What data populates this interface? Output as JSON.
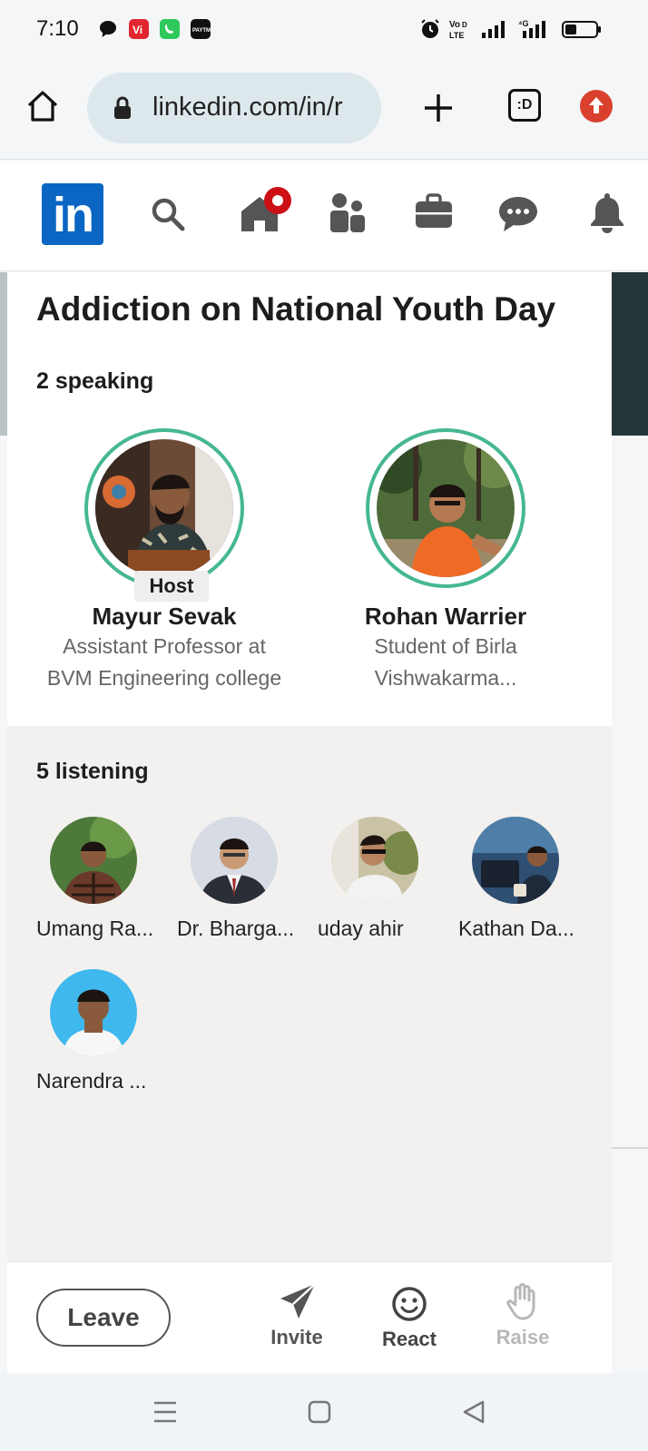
{
  "status_bar": {
    "time": "7:10"
  },
  "browser": {
    "url": "linkedin.com/in/r",
    "tab_switcher_label": ":D"
  },
  "linkedin_nav": {
    "logo": "in"
  },
  "room": {
    "title": "Addiction on National Youth Day",
    "speaking_count": "2 speaking",
    "speakers": [
      {
        "name": "Mayur Sevak",
        "badge": "Host",
        "subtitle_line1": "Assistant Professor at",
        "subtitle_line2": "BVM Engineering college"
      },
      {
        "name": "Rohan Warrier",
        "subtitle_line1": "Student of Birla",
        "subtitle_line2": "Vishwakarma..."
      }
    ],
    "listening_count": "5 listening",
    "listeners": [
      {
        "name": "Umang Ra..."
      },
      {
        "name": "Dr. Bharga..."
      },
      {
        "name": "uday ahir"
      },
      {
        "name": "Kathan Da..."
      },
      {
        "name": "Narendra ..."
      }
    ]
  },
  "actions": {
    "leave": "Leave",
    "invite": "Invite",
    "react": "React",
    "raise": "Raise"
  },
  "colors": {
    "accent_ring": "#45b890",
    "linkedin_blue": "#0a66c2",
    "notification_red": "#cc1016"
  }
}
